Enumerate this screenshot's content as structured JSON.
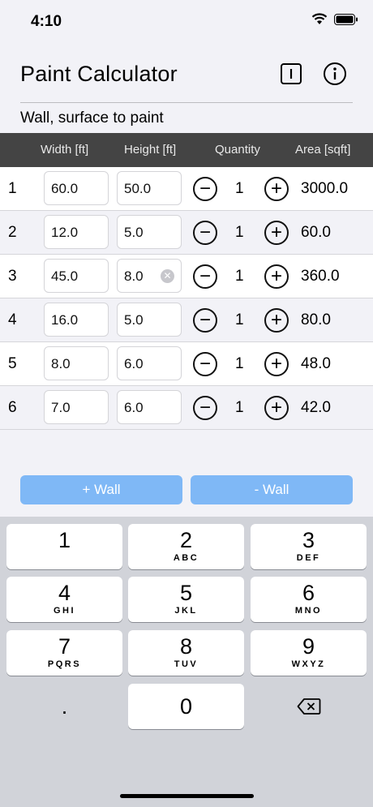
{
  "status": {
    "time": "4:10"
  },
  "nav": {
    "title": "Paint Calculator"
  },
  "subtitle": "Wall, surface to paint",
  "columns": {
    "width": "Width [ft]",
    "height": "Height [ft]",
    "quantity": "Quantity",
    "area": "Area [sqft]"
  },
  "rows": [
    {
      "n": "1",
      "width": "60.0",
      "height": "50.0",
      "qty": "1",
      "area": "3000.0"
    },
    {
      "n": "2",
      "width": "12.0",
      "height": "5.0",
      "qty": "1",
      "area": "60.0"
    },
    {
      "n": "3",
      "width": "45.0",
      "height": "8.0",
      "qty": "1",
      "area": "360.0"
    },
    {
      "n": "4",
      "width": "16.0",
      "height": "5.0",
      "qty": "1",
      "area": "80.0"
    },
    {
      "n": "5",
      "width": "8.0",
      "height": "6.0",
      "qty": "1",
      "area": "48.0"
    },
    {
      "n": "6",
      "width": "7.0",
      "height": "6.0",
      "qty": "1",
      "area": "42.0"
    }
  ],
  "buttons": {
    "add_wall": "+ Wall",
    "remove_wall": "- Wall"
  },
  "keypad": [
    {
      "num": "1",
      "letters": ""
    },
    {
      "num": "2",
      "letters": "ABC"
    },
    {
      "num": "3",
      "letters": "DEF"
    },
    {
      "num": "4",
      "letters": "GHI"
    },
    {
      "num": "5",
      "letters": "JKL"
    },
    {
      "num": "6",
      "letters": "MNO"
    },
    {
      "num": "7",
      "letters": "PQRS"
    },
    {
      "num": "8",
      "letters": "TUV"
    },
    {
      "num": "9",
      "letters": "WXYZ"
    },
    {
      "num": "0",
      "letters": ""
    }
  ],
  "keypad_extra": {
    "dot": "."
  },
  "colors": {
    "accent": "#7fb8f6",
    "header_bg": "#444444"
  }
}
